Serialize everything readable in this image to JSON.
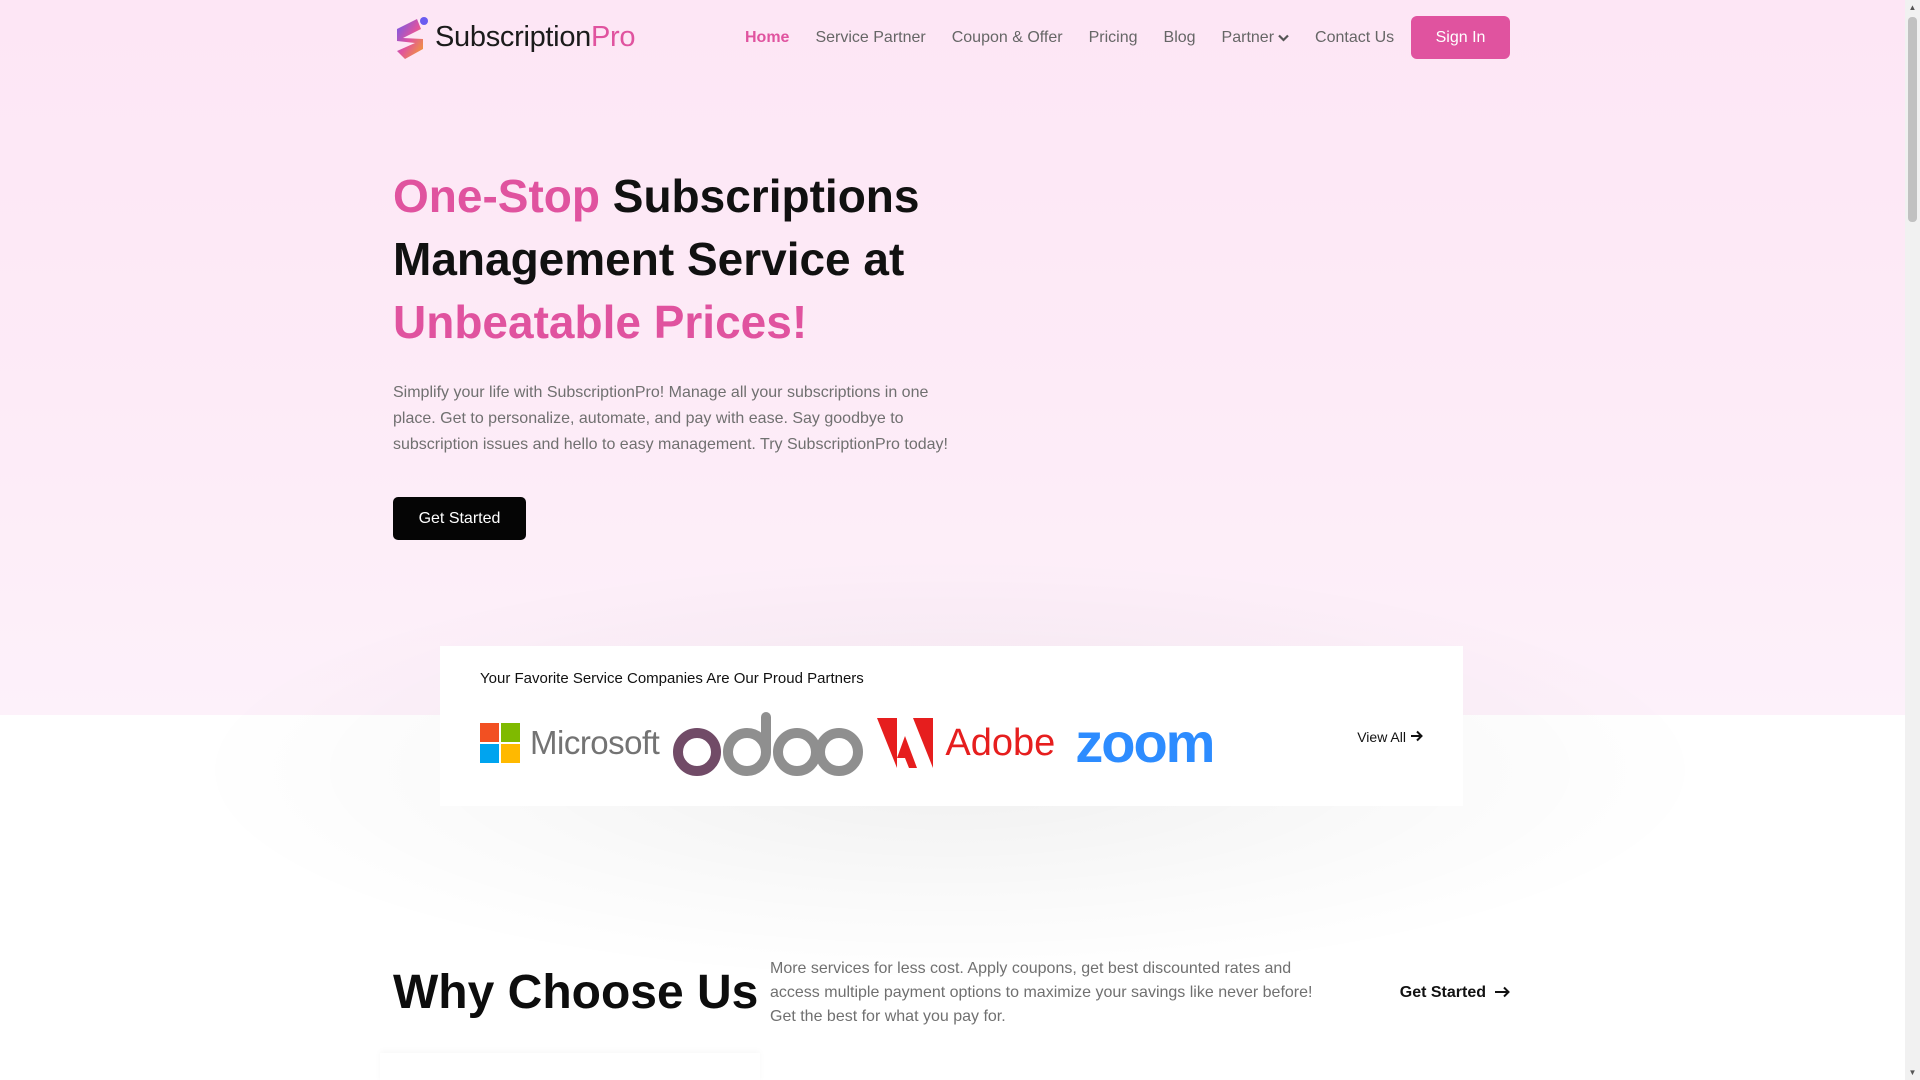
{
  "brand": {
    "name_dark": "Subscription",
    "name_pink": "Pro",
    "pink": "#e0539f"
  },
  "nav": {
    "items": [
      {
        "label": "Home",
        "active": true
      },
      {
        "label": "Service Partner"
      },
      {
        "label": "Coupon & Offer"
      },
      {
        "label": "Pricing"
      },
      {
        "label": "Blog"
      },
      {
        "label": "Partner",
        "dropdown": true
      },
      {
        "label": "Contact Us"
      }
    ],
    "sign_in": "Sign In"
  },
  "hero": {
    "headline_pink1": "One-Stop",
    "headline_dark": " Subscriptions Management Service at ",
    "headline_pink2": "Unbeatable Prices!",
    "description": "Simplify your life with SubscriptionPro! Manage all your subscriptions in one place. Get to personalize, automate, and pay with ease. Say goodbye to subscription issues and hello to easy management. Try SubscriptionPro today!",
    "cta": "Get Started"
  },
  "partners": {
    "title": "Your Favorite Service Companies Are Our Proud Partners",
    "logos": [
      {
        "name": "Microsoft",
        "icon": "microsoft-logo"
      },
      {
        "name": "odoo",
        "icon": "odoo-logo"
      },
      {
        "name": "Adobe",
        "icon": "adobe-logo"
      },
      {
        "name": "zoom",
        "icon": "zoom-logo"
      }
    ],
    "view_all": "View All"
  },
  "why": {
    "title": "Why Choose Us",
    "description": "More services for less cost. Apply coupons, get best discounted rates and access multiple payment options to maximize your savings like never before! Get the best for what you pay for.",
    "cta": "Get Started"
  }
}
